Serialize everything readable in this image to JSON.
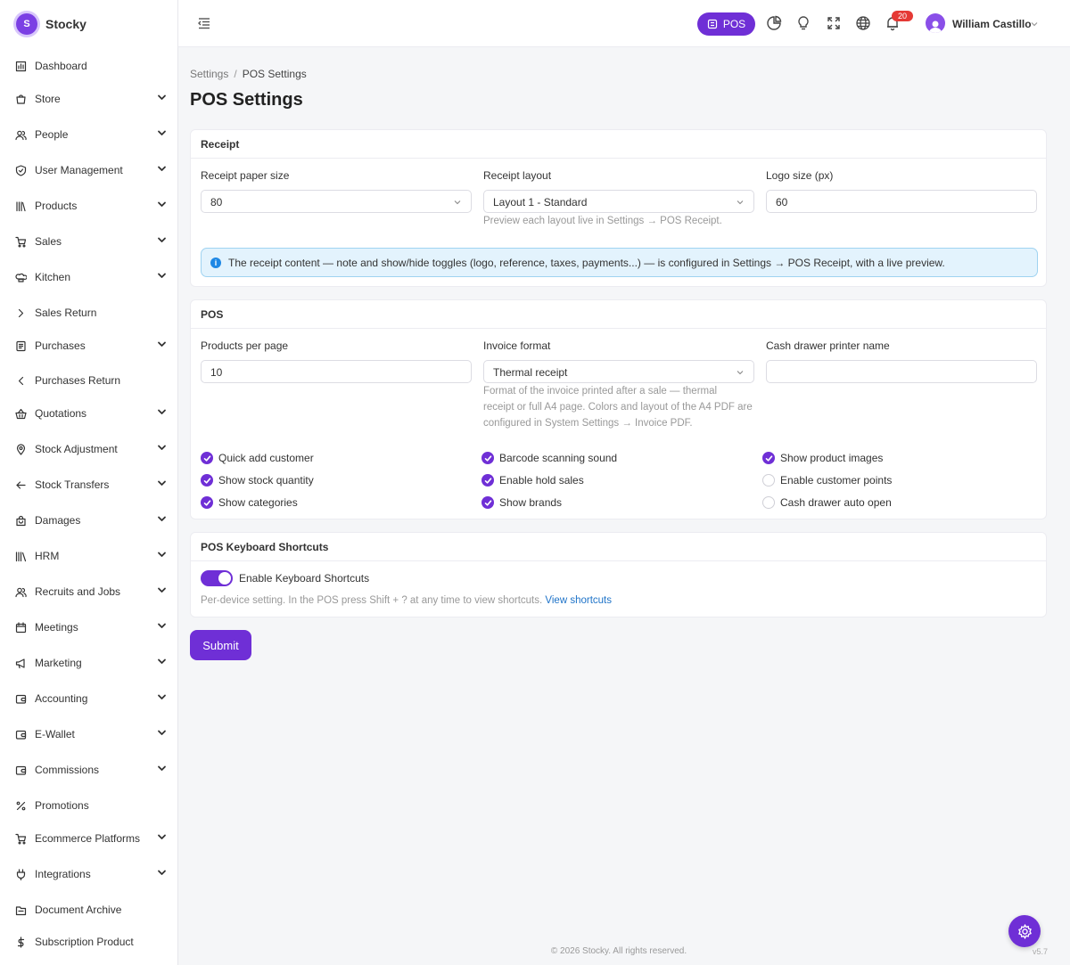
{
  "app": {
    "name": "Stocky",
    "logo_letter": "S",
    "accent": "#6f2fd6"
  },
  "sidebar": {
    "items": [
      {
        "label": "Dashboard",
        "icon": "chart-icon",
        "chevron": "none"
      },
      {
        "label": "Store",
        "icon": "store-icon",
        "chevron": "down"
      },
      {
        "label": "People",
        "icon": "people-icon",
        "chevron": "down"
      },
      {
        "label": "User Management",
        "icon": "shield-icon",
        "chevron": "down"
      },
      {
        "label": "Products",
        "icon": "books-icon",
        "chevron": "down"
      },
      {
        "label": "Sales",
        "icon": "cart-icon",
        "chevron": "down"
      },
      {
        "label": "Kitchen",
        "icon": "chef-hat-icon",
        "chevron": "down"
      },
      {
        "label": "Sales Return",
        "icon": "chevron-right-icon",
        "chevron": "none"
      },
      {
        "label": "Purchases",
        "icon": "receipt-icon",
        "chevron": "down"
      },
      {
        "label": "Purchases Return",
        "icon": "chevron-left-icon",
        "chevron": "none"
      },
      {
        "label": "Quotations",
        "icon": "basket-icon",
        "chevron": "down"
      },
      {
        "label": "Stock Adjustment",
        "icon": "location-pin-icon",
        "chevron": "down"
      },
      {
        "label": "Stock Transfers",
        "icon": "arrow-left-icon",
        "chevron": "down"
      },
      {
        "label": "Damages",
        "icon": "bag-icon",
        "chevron": "down"
      },
      {
        "label": "HRM",
        "icon": "library-icon",
        "chevron": "down"
      },
      {
        "label": "Recruits and Jobs",
        "icon": "people-icon",
        "chevron": "down"
      },
      {
        "label": "Meetings",
        "icon": "calendar-icon",
        "chevron": "down"
      },
      {
        "label": "Marketing",
        "icon": "megaphone-icon",
        "chevron": "down"
      },
      {
        "label": "Accounting",
        "icon": "wallet-icon",
        "chevron": "down"
      },
      {
        "label": "E-Wallet",
        "icon": "wallet-icon",
        "chevron": "down"
      },
      {
        "label": "Commissions",
        "icon": "wallet-icon",
        "chevron": "down"
      },
      {
        "label": "Promotions",
        "icon": "percent-icon",
        "chevron": "none"
      },
      {
        "label": "Ecommerce Platforms",
        "icon": "cart-icon",
        "chevron": "down"
      },
      {
        "label": "Integrations",
        "icon": "plug-icon",
        "chevron": "down"
      },
      {
        "label": "Document Archive",
        "icon": "folder-icon",
        "chevron": "none"
      },
      {
        "label": "Subscription Product",
        "icon": "dollar-icon",
        "chevron": "none"
      }
    ]
  },
  "topbar": {
    "pos_label": "POS",
    "notification_count": "20",
    "user_name": "William Castillo"
  },
  "breadcrumb": {
    "parent": "Settings",
    "separator": "/",
    "current": "POS Settings"
  },
  "page_title": "POS Settings",
  "receipt": {
    "title": "Receipt",
    "paper_size_label": "Receipt paper size",
    "paper_size_value": "80",
    "layout_label": "Receipt layout",
    "layout_value": "Layout 1 - Standard",
    "layout_help": "Preview each layout live in Settings → POS Receipt.",
    "logo_size_label": "Logo size (px)",
    "logo_size_value": "60",
    "info_text": "The receipt content — note and show/hide toggles (logo, reference, taxes, payments...) — is configured in Settings → POS Receipt, with a live preview."
  },
  "pos": {
    "title": "POS",
    "products_per_page_label": "Products per page",
    "products_per_page_value": "10",
    "invoice_format_label": "Invoice format",
    "invoice_format_value": "Thermal receipt",
    "invoice_help_lines": [
      "Format of the invoice printed after a sale — thermal",
      "receipt or full A4 page. Colors and layout of the A4 PDF are",
      "configured in System Settings → Invoice PDF."
    ],
    "cash_drawer_label": "Cash drawer printer name",
    "cash_drawer_value": "",
    "checkboxes": [
      {
        "label": "Quick add customer",
        "checked": true
      },
      {
        "label": "Show stock quantity",
        "checked": true
      },
      {
        "label": "Show categories",
        "checked": true
      },
      {
        "label": "Barcode scanning sound",
        "checked": true
      },
      {
        "label": "Enable hold sales",
        "checked": true
      },
      {
        "label": "Show brands",
        "checked": true
      },
      {
        "label": "Show product images",
        "checked": true
      },
      {
        "label": "Enable customer points",
        "checked": false
      },
      {
        "label": "Cash drawer auto open",
        "checked": false
      }
    ]
  },
  "shortcuts": {
    "title": "POS Keyboard Shortcuts",
    "toggle_label": "Enable Keyboard Shortcuts",
    "toggle_on": true,
    "help_text": "Per-device setting. In the POS press Shift + ? at any time to view shortcuts.",
    "link_text": "View shortcuts"
  },
  "submit_label": "Submit",
  "footer": "© 2026 Stocky. All rights reserved.",
  "version": "v5.7"
}
